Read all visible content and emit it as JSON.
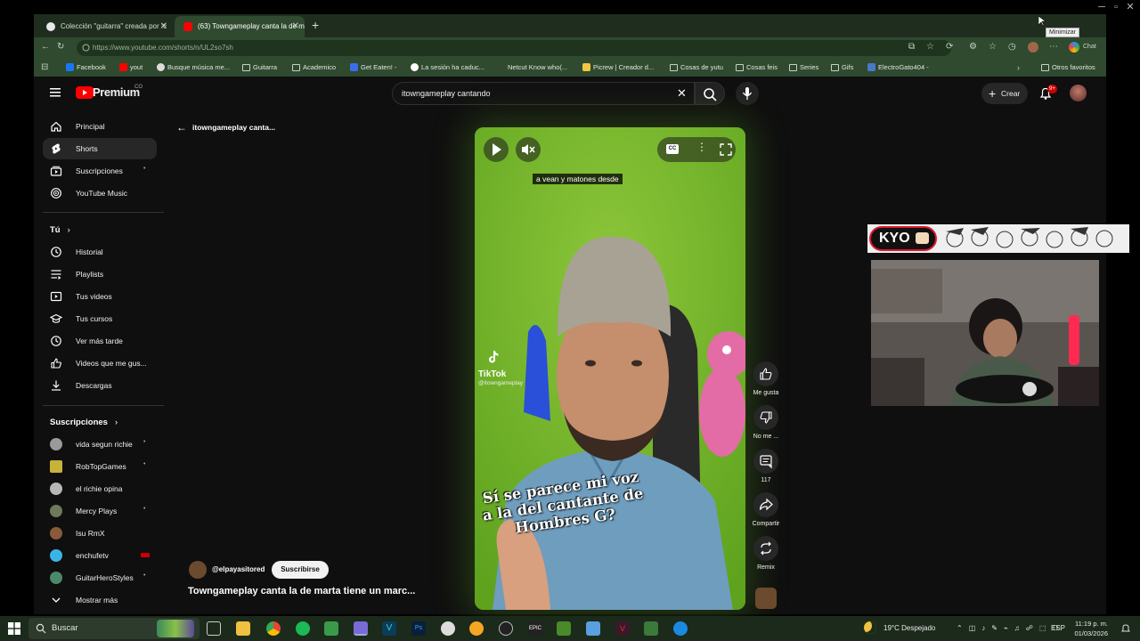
{
  "window": {
    "minimize_tooltip": "Minimizar"
  },
  "tabs": [
    {
      "title": "Colección \"guitarra\" creada por :c",
      "active": false
    },
    {
      "title": "(63) Towngameplay canta la de m",
      "active": true
    }
  ],
  "address": {
    "url": "https://www.youtube.com/shorts/n/UL2so7sh"
  },
  "profile_label": "Chat",
  "bookmarks": [
    {
      "label": "Facebook",
      "icon": "facebook-icon"
    },
    {
      "label": "yout",
      "icon": "youtube-icon"
    },
    {
      "label": "Busque música me...",
      "icon": "shazam-icon"
    },
    {
      "label": "Guitarra",
      "icon": "folder-icon"
    },
    {
      "label": "Academico",
      "icon": "folder-icon"
    },
    {
      "label": "Get Eaten! -",
      "icon": "game-icon"
    },
    {
      "label": "La sesión ha caduc...",
      "icon": "google-icon"
    },
    {
      "label": "Netcut Know who(...",
      "icon": "blank-icon"
    },
    {
      "label": "Picrew | Creador d...",
      "icon": "picrew-icon"
    },
    {
      "label": "Cosas de yutu",
      "icon": "folder-icon"
    },
    {
      "label": "Cosas feis",
      "icon": "folder-icon"
    },
    {
      "label": "Series",
      "icon": "folder-icon"
    },
    {
      "label": "Gifs",
      "icon": "folder-icon"
    },
    {
      "label": "ElectroGato404 -",
      "icon": "site-icon"
    }
  ],
  "bookmarks_other": "Otros favoritos",
  "youtube": {
    "logo": "Premium",
    "logo_region": "CO",
    "search_value": "itowngameplay cantando",
    "create_label": "Crear",
    "notif_badge": "9+",
    "back_label": "itowngameplay canta...",
    "sidebar": {
      "main": [
        {
          "label": "Principal",
          "icon": "home-icon",
          "active": false
        },
        {
          "label": "Shorts",
          "icon": "shorts-icon",
          "active": true
        },
        {
          "label": "Suscripciones",
          "icon": "subscriptions-icon",
          "active": false
        },
        {
          "label": "YouTube Music",
          "icon": "music-icon",
          "active": false
        }
      ],
      "you_header": "Tú",
      "you": [
        {
          "label": "Historial",
          "icon": "history-icon"
        },
        {
          "label": "Playlists",
          "icon": "playlist-icon"
        },
        {
          "label": "Tus videos",
          "icon": "video-icon"
        },
        {
          "label": "Tus cursos",
          "icon": "courses-icon"
        },
        {
          "label": "Ver más tarde",
          "icon": "watch-later-icon"
        },
        {
          "label": "Videos que me gus...",
          "icon": "like-icon"
        },
        {
          "label": "Descargas",
          "icon": "download-icon"
        }
      ],
      "subs_header": "Suscripciones",
      "subs": [
        {
          "label": "vida segun richie",
          "color": "#9a9a9a"
        },
        {
          "label": "RobTopGames",
          "color": "#c9b23a"
        },
        {
          "label": "el richie opina",
          "color": "#b7b7b7"
        },
        {
          "label": "Mercy Plays",
          "color": "#6c7a5a"
        },
        {
          "label": "Isu RmX",
          "color": "#8a5a3a"
        },
        {
          "label": "enchufetv",
          "color": "#3ab4e6"
        },
        {
          "label": "GuitarHeroStyles",
          "color": "#4a8a6a"
        }
      ],
      "show_more": "Mostrar más"
    },
    "video": {
      "caption": "a vean y matones desde",
      "overlay_text": "Sí se parece mi voz a la del cantante de Hombres G?",
      "watermark": "TikTok",
      "watermark_handle": "@itowngameplay"
    },
    "actions": {
      "like": "Me gusta",
      "dislike": "No me ...",
      "comments": "117",
      "share": "Compartir",
      "remix": "Remix"
    },
    "channel": "@elpayasitored",
    "subscribe": "Suscribirse",
    "title": "Towngameplay canta la de marta tiene un marc..."
  },
  "overlay": {
    "name": "KYO"
  },
  "taskbar": {
    "search": "Buscar",
    "weather": "19°C  Despejado",
    "lang": "ESP",
    "time": "11:19 p. m.",
    "date": "01/03/2026"
  },
  "colors": {
    "accent_green": "#2f4a2f",
    "yt_red": "#ff0000",
    "kyo_red": "#e0182d"
  }
}
